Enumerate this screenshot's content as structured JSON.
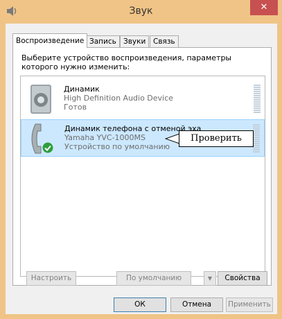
{
  "window": {
    "title": "Звук",
    "close_symbol": "✕"
  },
  "tabs": [
    {
      "label": "Воспроизведение",
      "active": true
    },
    {
      "label": "Запись"
    },
    {
      "label": "Звуки"
    },
    {
      "label": "Связь"
    }
  ],
  "instruction": "Выберите устройство воспроизведения, параметры которого нужно изменить:",
  "devices": [
    {
      "name": "Динамик",
      "detail": "High Definition Audio Device",
      "status": "Готов",
      "icon": "speaker-icon"
    },
    {
      "name": "Динамик телефона с отменой эха",
      "detail": "Yamaha YVC-1000MS",
      "status": "Устройство по умолчанию",
      "icon": "handset-icon",
      "default_badge": "checkmark-icon",
      "selected": true
    }
  ],
  "callout": "Проверить",
  "buttons": {
    "configure": "Настроить",
    "set_default": "По умолчанию",
    "properties": "Свойства",
    "ok": "ОК",
    "cancel": "Отмена",
    "apply": "Применить"
  },
  "colors": {
    "frame": "#f0c486",
    "close": "#c75050",
    "selection": "#cce8ff",
    "accent": "#3c7fb1"
  }
}
